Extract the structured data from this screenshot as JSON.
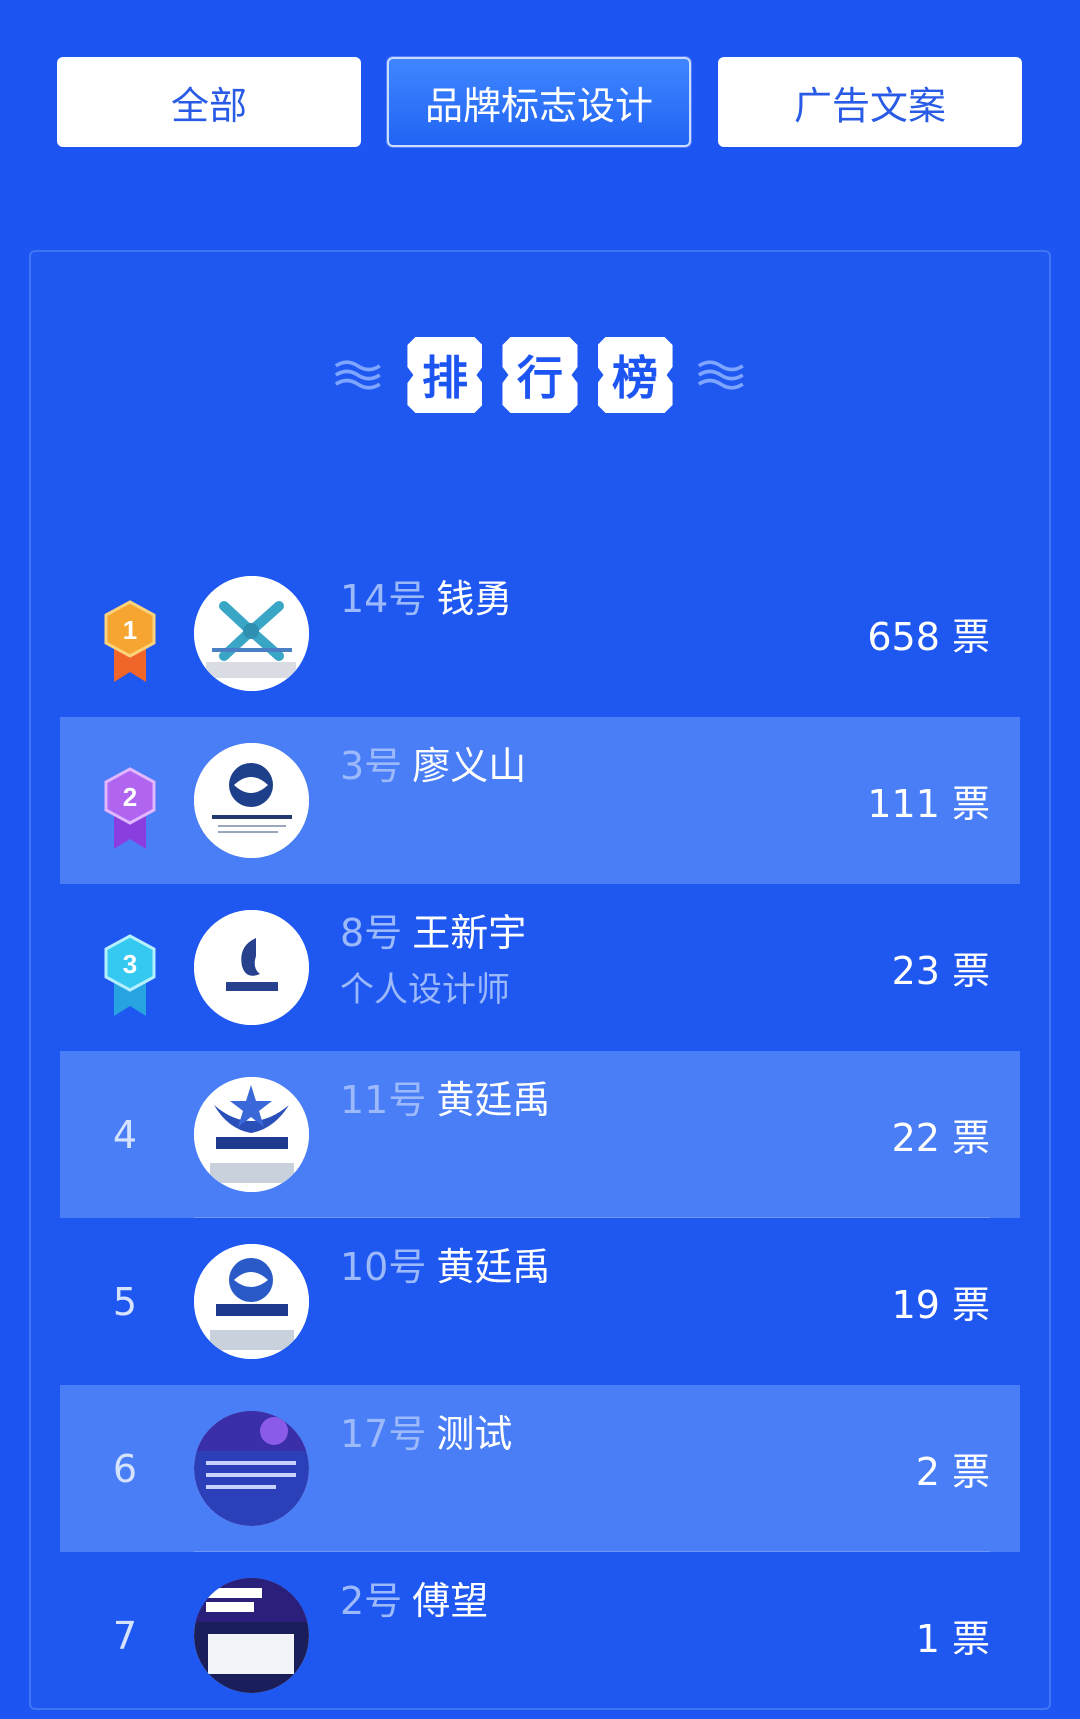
{
  "tabs": [
    {
      "label": "全部",
      "active": false
    },
    {
      "label": "品牌标志设计",
      "active": true
    },
    {
      "label": "广告文案",
      "active": false
    }
  ],
  "ranking": {
    "title_chars": [
      "排",
      "行",
      "榜"
    ],
    "rows": [
      {
        "rank": "1",
        "number": "14号",
        "name": "钱勇",
        "subtitle": "",
        "votes": "658 票"
      },
      {
        "rank": "2",
        "number": "3号",
        "name": "廖义山",
        "subtitle": "",
        "votes": "111 票"
      },
      {
        "rank": "3",
        "number": "8号",
        "name": "王新宇",
        "subtitle": "个人设计师",
        "votes": "23 票"
      },
      {
        "rank": "4",
        "number": "11号",
        "name": "黄廷禹",
        "subtitle": "",
        "votes": "22 票"
      },
      {
        "rank": "5",
        "number": "10号",
        "name": "黄廷禹",
        "subtitle": "",
        "votes": "19 票"
      },
      {
        "rank": "6",
        "number": "17号",
        "name": "测试",
        "subtitle": "",
        "votes": "2 票"
      },
      {
        "rank": "7",
        "number": "2号",
        "name": "傅望",
        "subtitle": "",
        "votes": "1 票"
      }
    ]
  },
  "colors": {
    "background": "#1d55f2",
    "alt_row": "#4a7ef6",
    "gold_badge": "#f7a531",
    "silver_badge": "#b064f0",
    "bronze_badge": "#35c8f0"
  }
}
